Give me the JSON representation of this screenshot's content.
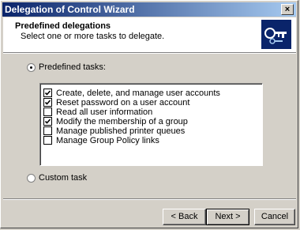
{
  "window": {
    "title": "Delegation of Control Wizard",
    "close_label": "×"
  },
  "header": {
    "title": "Predefined delegations",
    "subtitle": "Select one or more tasks to delegate.",
    "icon": "wizard-keys-icon"
  },
  "options": {
    "predefined_label": "Predefined tasks:",
    "predefined_selected": true,
    "custom_label": "Custom task",
    "custom_selected": false
  },
  "tasks": [
    {
      "label": "Create, delete, and manage user accounts",
      "checked": true
    },
    {
      "label": "Reset password on a user account",
      "checked": true
    },
    {
      "label": "Read all user information",
      "checked": false
    },
    {
      "label": "Modify the membership of a group",
      "checked": true
    },
    {
      "label": "Manage published printer queues",
      "checked": false
    },
    {
      "label": "Manage Group Policy links",
      "checked": false
    }
  ],
  "buttons": {
    "back_label": "< Back",
    "next_label": "Next >",
    "cancel_label": "Cancel"
  }
}
